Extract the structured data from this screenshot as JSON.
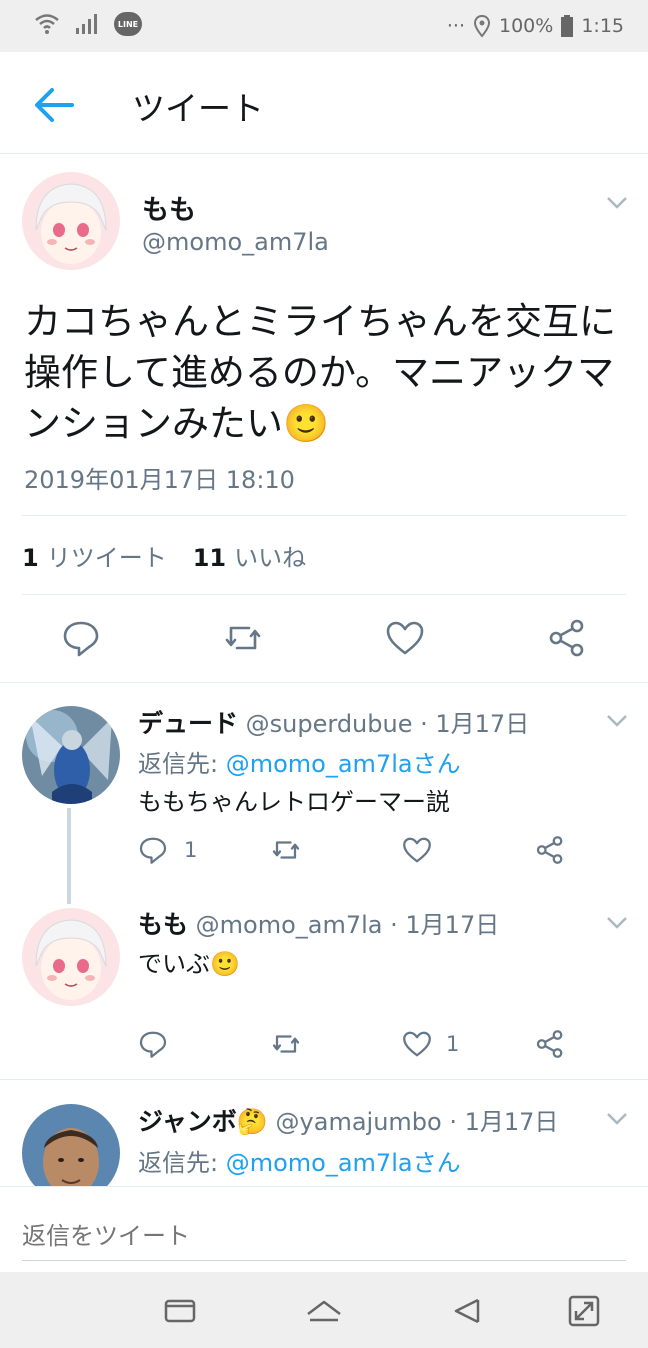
{
  "status_bar": {
    "left_icons": [
      "wifi-icon",
      "signal-icon",
      "line-app-icon"
    ],
    "line_label": "LINE",
    "dots": "···",
    "battery": "100%",
    "time": "1:15"
  },
  "header": {
    "title": "ツイート"
  },
  "tweet": {
    "name": "もも",
    "handle": "@momo_am7la",
    "text": "カコちゃんとミライちゃんを交互に操作して進めるのか。マニアックマンションみたい🙂",
    "timestamp": "2019年01月17日 18:10",
    "retweet_count": "1",
    "retweet_label": "リツイート",
    "like_count": "11",
    "like_label": "いいね"
  },
  "replies": [
    {
      "name": "デュード",
      "handle": "@superdubue",
      "date": "· 1月17日",
      "reply_to_label": "返信先: ",
      "reply_to": "@momo_am7laさん",
      "text": "ももちゃんレトロゲーマー説",
      "reply_count": "1",
      "like_count": ""
    },
    {
      "name": "もも",
      "handle": "@momo_am7la",
      "date": "· 1月17日",
      "text": "でいぶ🙂",
      "reply_count": "",
      "like_count": "1"
    },
    {
      "name": "ジャンボ🤔",
      "handle": "@yamajumbo",
      "date": "· 1月17日",
      "reply_to_label": "返信先: ",
      "reply_to": "@momo_am7laさん"
    }
  ],
  "reply_box": {
    "placeholder": "返信をツイート"
  },
  "colors": {
    "accent": "#1da1f2",
    "text": "#14171a",
    "muted": "#657786",
    "divider": "#e6ecf0"
  }
}
